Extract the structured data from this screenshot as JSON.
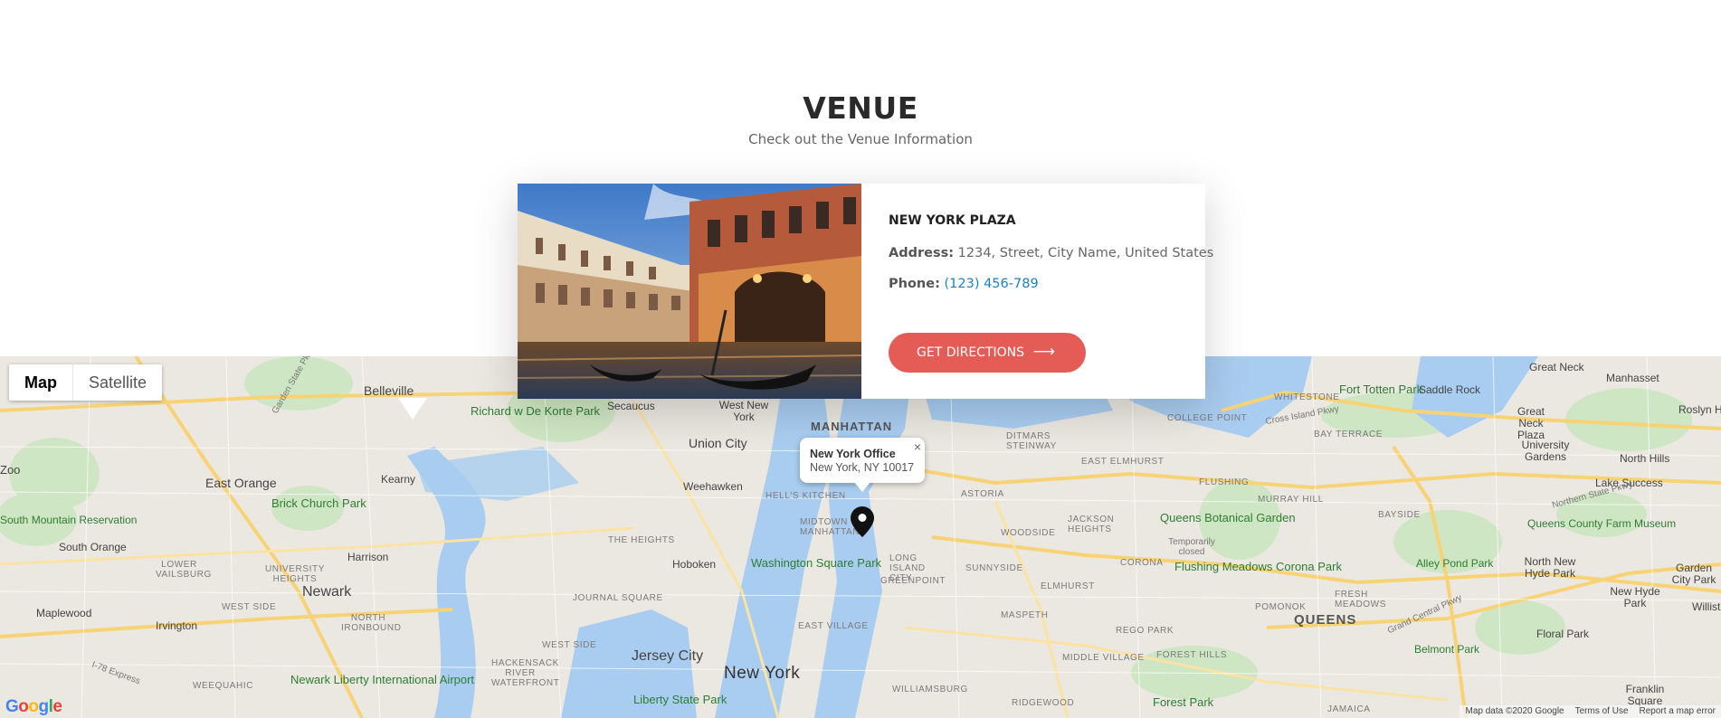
{
  "section": {
    "title": "VENUE",
    "subtitle": "Check out the Venue Information"
  },
  "venue": {
    "name": "NEW YORK PLAZA",
    "address_label": "Address:",
    "address": "1234, Street, City Name, United States",
    "phone_label": "Phone:",
    "phone": "(123) 456-789",
    "button_label": "GET DIRECTIONS",
    "button_icon": "arrow-right-icon",
    "accent_color": "#e45c55",
    "link_color": "#1e7fc1"
  },
  "map": {
    "type_options": [
      "Map",
      "Satellite"
    ],
    "selected_type": "Map",
    "info_window": {
      "title": "New York Office",
      "address": "New York, NY 10017",
      "close": "×"
    },
    "labels": {
      "belleville": "Belleville",
      "secaucus": "Secaucus",
      "west_new_york": "West New York",
      "manhattan": "MANHATTAN",
      "union_city": "Union City",
      "weehawken": "Weehawken",
      "hells_kitchen": "HELL'S KITCHEN",
      "midtown": "MIDTOWN MANHATTAN",
      "the_heights": "THE HEIGHTS",
      "hoboken": "Hoboken",
      "washington_sq": "Washington Square Park",
      "east_village": "EAST VILLAGE",
      "jersey_city": "Jersey City",
      "new_york": "New York",
      "williamsburg": "WILLIAMSBURG",
      "greenpoint": "GREENPOINT",
      "long_island_city": "LONG ISLAND CITY",
      "sunnyside": "SUNNYSIDE",
      "woodside": "WOODSIDE",
      "astoria": "ASTORIA",
      "ditmars": "DITMARS STEINWAY",
      "east_elmhurst": "EAST ELMHURST",
      "jackson_heights": "JACKSON HEIGHTS",
      "corona": "CORONA",
      "elmhurst": "ELMHURST",
      "maspeth": "MASPETH",
      "middle_village": "MIDDLE VILLAGE",
      "rego_park": "REGO PARK",
      "forest_hills": "FOREST HILLS",
      "ridgewood": "RIDGEWOOD",
      "forest_park": "Forest Park",
      "flushing": "FLUSHING",
      "murray_hill": "MURRAY HILL",
      "queens_botanical": "Queens Botanical Garden",
      "temp_closed": "Temporarily closed",
      "flushing_meadows": "Flushing Meadows Corona Park",
      "queens": "QUEENS",
      "pomonok": "POMONOK",
      "fresh_meadows": "FRESH MEADOWS",
      "college_point": "COLLEGE POINT",
      "whitestone": "WHITESTONE",
      "bay_terrace": "BAY TERRACE",
      "bayside": "BAYSIDE",
      "fort_totten": "Fort Totten Park",
      "saddle_rock": "Saddle Rock",
      "great_neck": "Great Neck",
      "great_neck_plaza": "Great Neck Plaza",
      "manhasset": "Manhasset",
      "roslyn": "Roslyn He",
      "university_gardens": "University Gardens",
      "north_hills": "North Hills",
      "lake_success": "Lake Success",
      "queens_county_farm": "Queens County Farm Museum",
      "alley_pond": "Alley Pond Park",
      "north_new_hyde": "North New Hyde Park",
      "new_hyde": "New Hyde Park",
      "garden_city": "Garden City Park",
      "willisto": "Willisto",
      "belmont": "Belmont Park",
      "floral_park": "Floral Park",
      "franklin_sq": "Franklin Square",
      "jamaica": "JAMAICA",
      "east_orange": "East Orange",
      "brick_church": "Brick Church Park",
      "kearny": "Kearny",
      "harrison": "Harrison",
      "newark": "Newark",
      "south_orange": "South Orange",
      "south_mountain": "South Mountain Reservation",
      "lower_vailsburg": "LOWER VAILSBURG",
      "university_heights": "UNIVERSITY HEIGHTS",
      "west_side": "WEST SIDE",
      "maplewood": "Maplewood",
      "irvington": "Irvington",
      "north_ironbound": "NORTH IRONBOUND",
      "west_side2": "WEST SIDE",
      "journal_square": "JOURNAL SQUARE",
      "hackensack_river": "HACKENSACK RIVER WATERFRONT",
      "weequahic": "WEEQUAHIC",
      "newark_airport": "Newark Liberty International Airport",
      "liberty_park": "Liberty State Park",
      "richard_korte": "Richard w De Korte Park",
      "zoo": "Zoo",
      "i78": "I-78 Express",
      "garden_state_pkwy": "Garden State Pkwy",
      "cross_island": "Cross Island Pkwy",
      "northern_state": "Northern State Pkwy",
      "grand_central": "Grand Central Pkwy"
    },
    "attribution": {
      "logo": "Google",
      "data": "Map data ©2020 Google",
      "terms": "Terms of Use",
      "report": "Report a map error"
    }
  }
}
